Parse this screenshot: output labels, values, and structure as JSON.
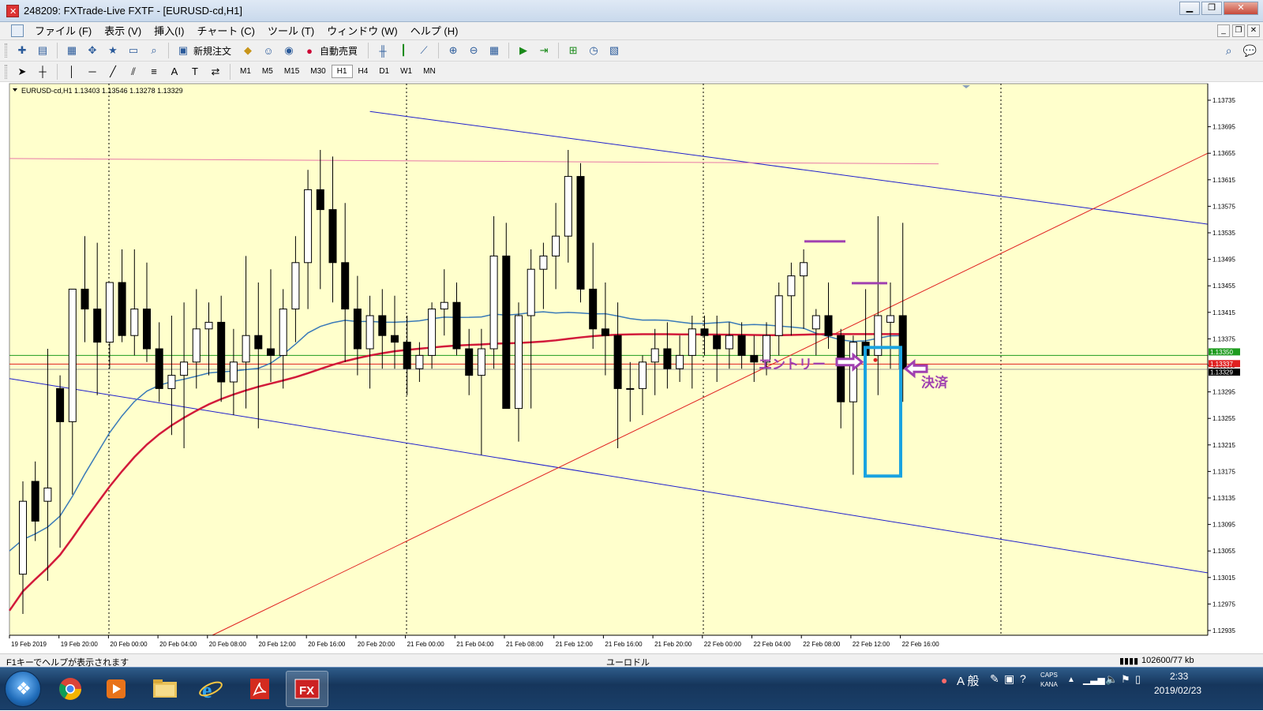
{
  "window": {
    "title": "248209: FXTrade-Live FXTF - [EURUSD-cd,H1]"
  },
  "menu": [
    "ファイル (F)",
    "表示 (V)",
    "挿入(I)",
    "チャート (C)",
    "ツール (T)",
    "ウィンドウ (W)",
    "ヘルプ (H)"
  ],
  "toolbar": {
    "new_order": "新規注文",
    "auto_trading": "自動売買",
    "timeframes": [
      "M1",
      "M5",
      "M15",
      "M30",
      "H1",
      "H4",
      "D1",
      "W1",
      "MN"
    ],
    "active_timeframe": "H1"
  },
  "chart_data": {
    "type": "candlestick",
    "symbol_info": "EURUSD-cd,H1  1.13403 1.13546 1.13278 1.13329",
    "background": "#ffffcc",
    "price_axis": {
      "min": 1.12935,
      "max": 1.13735,
      "ticks": [
        "1.13735",
        "1.13695",
        "1.13655",
        "1.13615",
        "1.13575",
        "1.13535",
        "1.13495",
        "1.13455",
        "1.13415",
        "1.13375",
        "1.13335",
        "1.13295",
        "1.13255",
        "1.13215",
        "1.13175",
        "1.13135",
        "1.13095",
        "1.13055",
        "1.13015",
        "1.12975",
        "1.12935"
      ]
    },
    "time_axis": [
      "19 Feb 2019",
      "19 Feb 20:00",
      "20 Feb 00:00",
      "20 Feb 04:00",
      "20 Feb 08:00",
      "20 Feb 12:00",
      "20 Feb 16:00",
      "20 Feb 20:00",
      "21 Feb 00:00",
      "21 Feb 04:00",
      "21 Feb 08:00",
      "21 Feb 12:00",
      "21 Feb 16:00",
      "21 Feb 20:00",
      "22 Feb 00:00",
      "22 Feb 04:00",
      "22 Feb 08:00",
      "22 Feb 12:00",
      "22 Feb 16:00"
    ],
    "price_labels": {
      "green_level": "1.13350",
      "red_level": "1.13337",
      "current_price": "1.13329"
    },
    "candles": [
      {
        "o": 1.1302,
        "h": 1.1316,
        "l": 1.1296,
        "c": 1.1313
      },
      {
        "o": 1.1316,
        "h": 1.1319,
        "l": 1.1307,
        "c": 1.131
      },
      {
        "o": 1.1313,
        "h": 1.1336,
        "l": 1.1301,
        "c": 1.1315
      },
      {
        "o": 1.133,
        "h": 1.1332,
        "l": 1.1306,
        "c": 1.1325
      },
      {
        "o": 1.1325,
        "h": 1.1345,
        "l": 1.1314,
        "c": 1.1345
      },
      {
        "o": 1.1345,
        "h": 1.1353,
        "l": 1.1337,
        "c": 1.1342
      },
      {
        "o": 1.1342,
        "h": 1.1352,
        "l": 1.1329,
        "c": 1.1337
      },
      {
        "o": 1.1337,
        "h": 1.1343,
        "l": 1.1333,
        "c": 1.1346
      },
      {
        "o": 1.1346,
        "h": 1.1351,
        "l": 1.1337,
        "c": 1.1338
      },
      {
        "o": 1.1338,
        "h": 1.1351,
        "l": 1.1335,
        "c": 1.1342
      },
      {
        "o": 1.1342,
        "h": 1.1349,
        "l": 1.1334,
        "c": 1.1336
      },
      {
        "o": 1.1336,
        "h": 1.134,
        "l": 1.1328,
        "c": 1.133
      },
      {
        "o": 1.133,
        "h": 1.1341,
        "l": 1.1323,
        "c": 1.1332
      },
      {
        "o": 1.1332,
        "h": 1.1343,
        "l": 1.1321,
        "c": 1.1334
      },
      {
        "o": 1.1334,
        "h": 1.1345,
        "l": 1.133,
        "c": 1.1339
      },
      {
        "o": 1.1339,
        "h": 1.1343,
        "l": 1.1332,
        "c": 1.134
      },
      {
        "o": 1.134,
        "h": 1.1344,
        "l": 1.1328,
        "c": 1.1331
      },
      {
        "o": 1.1331,
        "h": 1.1339,
        "l": 1.1326,
        "c": 1.1334
      },
      {
        "o": 1.1334,
        "h": 1.135,
        "l": 1.1327,
        "c": 1.1338
      },
      {
        "o": 1.1338,
        "h": 1.1346,
        "l": 1.1324,
        "c": 1.1336
      },
      {
        "o": 1.1336,
        "h": 1.1348,
        "l": 1.1331,
        "c": 1.1335
      },
      {
        "o": 1.1335,
        "h": 1.1345,
        "l": 1.133,
        "c": 1.1342
      },
      {
        "o": 1.1342,
        "h": 1.1353,
        "l": 1.1337,
        "c": 1.1349
      },
      {
        "o": 1.1349,
        "h": 1.1363,
        "l": 1.1342,
        "c": 1.136
      },
      {
        "o": 1.136,
        "h": 1.1366,
        "l": 1.1345,
        "c": 1.1357
      },
      {
        "o": 1.1357,
        "h": 1.1365,
        "l": 1.1343,
        "c": 1.1349
      },
      {
        "o": 1.1349,
        "h": 1.1358,
        "l": 1.1334,
        "c": 1.1342
      },
      {
        "o": 1.1342,
        "h": 1.1347,
        "l": 1.1332,
        "c": 1.1336
      },
      {
        "o": 1.1336,
        "h": 1.1344,
        "l": 1.133,
        "c": 1.1341
      },
      {
        "o": 1.1341,
        "h": 1.1345,
        "l": 1.1333,
        "c": 1.1338
      },
      {
        "o": 1.1338,
        "h": 1.1344,
        "l": 1.1333,
        "c": 1.1337
      },
      {
        "o": 1.1337,
        "h": 1.1341,
        "l": 1.1329,
        "c": 1.1333
      },
      {
        "o": 1.1333,
        "h": 1.1337,
        "l": 1.1331,
        "c": 1.1335
      },
      {
        "o": 1.1335,
        "h": 1.1343,
        "l": 1.1333,
        "c": 1.1342
      },
      {
        "o": 1.1342,
        "h": 1.1348,
        "l": 1.1338,
        "c": 1.1343
      },
      {
        "o": 1.1343,
        "h": 1.1346,
        "l": 1.1335,
        "c": 1.1336
      },
      {
        "o": 1.1336,
        "h": 1.1339,
        "l": 1.1329,
        "c": 1.1332
      },
      {
        "o": 1.1332,
        "h": 1.1339,
        "l": 1.132,
        "c": 1.1336
      },
      {
        "o": 1.1336,
        "h": 1.1356,
        "l": 1.1333,
        "c": 1.135
      },
      {
        "o": 1.135,
        "h": 1.1355,
        "l": 1.1327,
        "c": 1.1327
      },
      {
        "o": 1.1327,
        "h": 1.1343,
        "l": 1.1322,
        "c": 1.1341
      },
      {
        "o": 1.1341,
        "h": 1.1351,
        "l": 1.1327,
        "c": 1.1348
      },
      {
        "o": 1.1348,
        "h": 1.1352,
        "l": 1.1342,
        "c": 1.135
      },
      {
        "o": 1.135,
        "h": 1.1358,
        "l": 1.1345,
        "c": 1.1353
      },
      {
        "o": 1.1353,
        "h": 1.1366,
        "l": 1.1349,
        "c": 1.1362
      },
      {
        "o": 1.1362,
        "h": 1.1364,
        "l": 1.1343,
        "c": 1.1345
      },
      {
        "o": 1.1345,
        "h": 1.1352,
        "l": 1.1336,
        "c": 1.1339
      },
      {
        "o": 1.1339,
        "h": 1.1346,
        "l": 1.1332,
        "c": 1.1338
      },
      {
        "o": 1.1338,
        "h": 1.1343,
        "l": 1.1321,
        "c": 1.133
      },
      {
        "o": 1.133,
        "h": 1.1334,
        "l": 1.1325,
        "c": 1.133
      },
      {
        "o": 1.133,
        "h": 1.1335,
        "l": 1.1326,
        "c": 1.1334
      },
      {
        "o": 1.1334,
        "h": 1.1339,
        "l": 1.1329,
        "c": 1.1336
      },
      {
        "o": 1.1336,
        "h": 1.134,
        "l": 1.133,
        "c": 1.1333
      },
      {
        "o": 1.1333,
        "h": 1.1338,
        "l": 1.1331,
        "c": 1.1335
      },
      {
        "o": 1.1335,
        "h": 1.1341,
        "l": 1.133,
        "c": 1.1339
      },
      {
        "o": 1.1339,
        "h": 1.1341,
        "l": 1.1335,
        "c": 1.1338
      },
      {
        "o": 1.1338,
        "h": 1.1341,
        "l": 1.1331,
        "c": 1.1336
      },
      {
        "o": 1.1336,
        "h": 1.134,
        "l": 1.1333,
        "c": 1.1338
      },
      {
        "o": 1.1338,
        "h": 1.134,
        "l": 1.1333,
        "c": 1.1335
      },
      {
        "o": 1.1335,
        "h": 1.1338,
        "l": 1.1331,
        "c": 1.1334
      },
      {
        "o": 1.1334,
        "h": 1.134,
        "l": 1.1332,
        "c": 1.1338
      },
      {
        "o": 1.1338,
        "h": 1.1346,
        "l": 1.1335,
        "c": 1.1344
      },
      {
        "o": 1.1344,
        "h": 1.1349,
        "l": 1.1338,
        "c": 1.1347
      },
      {
        "o": 1.1347,
        "h": 1.1351,
        "l": 1.1339,
        "c": 1.1349
      },
      {
        "o": 1.1339,
        "h": 1.1342,
        "l": 1.1335,
        "c": 1.1341
      },
      {
        "o": 1.1341,
        "h": 1.1346,
        "l": 1.1336,
        "c": 1.1338
      },
      {
        "o": 1.1338,
        "h": 1.1339,
        "l": 1.1324,
        "c": 1.1328
      },
      {
        "o": 1.1328,
        "h": 1.1338,
        "l": 1.1317,
        "c": 1.1337
      },
      {
        "o": 1.1337,
        "h": 1.1345,
        "l": 1.1332,
        "c": 1.1335
      },
      {
        "o": 1.1335,
        "h": 1.1356,
        "l": 1.1329,
        "c": 1.1341
      },
      {
        "o": 1.134,
        "h": 1.1346,
        "l": 1.1333,
        "c": 1.1341
      },
      {
        "o": 1.1341,
        "h": 1.1355,
        "l": 1.1328,
        "c": 1.1333
      }
    ],
    "annotations": {
      "entry": "エントリー",
      "settle": "決済"
    }
  },
  "status": {
    "help": "F1キーでヘルプが表示されます",
    "profile": "ユーロドル",
    "traffic": "102600/77 kb"
  },
  "taskbar": {
    "ime": "A 般",
    "caps": "CAPS",
    "kana": "KANA",
    "time": "2:33",
    "date": "2019/02/23"
  }
}
